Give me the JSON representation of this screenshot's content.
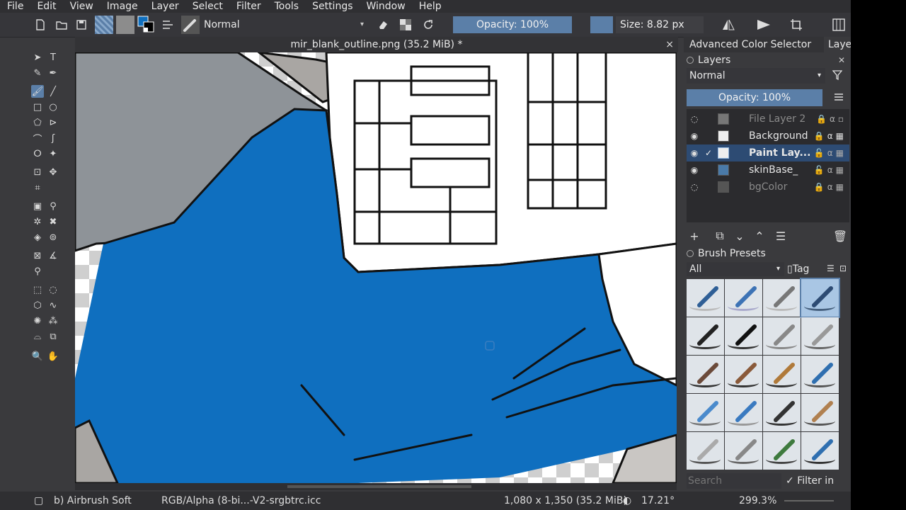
{
  "menu": [
    "File",
    "Edit",
    "View",
    "Image",
    "Layer",
    "Select",
    "Filter",
    "Tools",
    "Settings",
    "Window",
    "Help"
  ],
  "toolbar": {
    "blend_mode": "Normal",
    "opacity_label": "Opacity: 100%",
    "size_label": "Size: 8.82 px"
  },
  "document": {
    "tab_title": "mir_blank_outline.png (35.2 MiB) *",
    "close_glyph": "×"
  },
  "panel_tabs": [
    "Advanced Color Selector",
    "Layers"
  ],
  "layers_dock": {
    "title": "Layers",
    "blend_mode": "Normal",
    "opacity_label": "Opacity:  100%",
    "layers": [
      {
        "name": "File Layer 2",
        "visible": false,
        "selected": false
      },
      {
        "name": "Background",
        "visible": true,
        "selected": false
      },
      {
        "name": "Paint Lay...",
        "visible": true,
        "selected": true
      },
      {
        "name": "skinBase_",
        "visible": true,
        "selected": false
      },
      {
        "name": "bgColor",
        "visible": false,
        "selected": false
      }
    ]
  },
  "brush_presets": {
    "title": "Brush Presets",
    "filter": "All",
    "tag_label": "Tag",
    "search_placeholder": "Search",
    "filter_in_tag": "Filter in Tag"
  },
  "status": {
    "brush": "b) Airbrush Soft",
    "color_profile": "RGB/Alpha (8-bi...-V2-srgbtrc.icc",
    "dimensions": "1,080 x 1,350 (35.2 MiB)",
    "rotation": "17.21°",
    "zoom": "299.3%"
  },
  "colors": {
    "accent": "#5b7fa8",
    "shirt_blue": "#0f6fbf",
    "selected_layer": "#2d4b73"
  }
}
